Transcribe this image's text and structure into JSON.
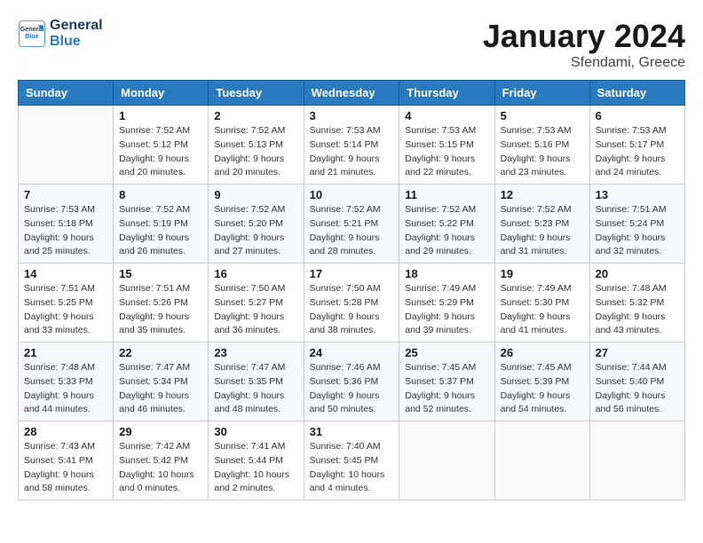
{
  "header": {
    "logo_general": "General",
    "logo_blue": "Blue",
    "title": "January 2024",
    "subtitle": "Sfendami, Greece"
  },
  "columns": [
    "Sunday",
    "Monday",
    "Tuesday",
    "Wednesday",
    "Thursday",
    "Friday",
    "Saturday"
  ],
  "weeks": [
    [
      {
        "day": "",
        "info": ""
      },
      {
        "day": "1",
        "info": "Sunrise: 7:52 AM\nSunset: 5:12 PM\nDaylight: 9 hours\nand 20 minutes."
      },
      {
        "day": "2",
        "info": "Sunrise: 7:52 AM\nSunset: 5:13 PM\nDaylight: 9 hours\nand 20 minutes."
      },
      {
        "day": "3",
        "info": "Sunrise: 7:53 AM\nSunset: 5:14 PM\nDaylight: 9 hours\nand 21 minutes."
      },
      {
        "day": "4",
        "info": "Sunrise: 7:53 AM\nSunset: 5:15 PM\nDaylight: 9 hours\nand 22 minutes."
      },
      {
        "day": "5",
        "info": "Sunrise: 7:53 AM\nSunset: 5:16 PM\nDaylight: 9 hours\nand 23 minutes."
      },
      {
        "day": "6",
        "info": "Sunrise: 7:53 AM\nSunset: 5:17 PM\nDaylight: 9 hours\nand 24 minutes."
      }
    ],
    [
      {
        "day": "7",
        "info": "Sunrise: 7:53 AM\nSunset: 5:18 PM\nDaylight: 9 hours\nand 25 minutes."
      },
      {
        "day": "8",
        "info": "Sunrise: 7:52 AM\nSunset: 5:19 PM\nDaylight: 9 hours\nand 26 minutes."
      },
      {
        "day": "9",
        "info": "Sunrise: 7:52 AM\nSunset: 5:20 PM\nDaylight: 9 hours\nand 27 minutes."
      },
      {
        "day": "10",
        "info": "Sunrise: 7:52 AM\nSunset: 5:21 PM\nDaylight: 9 hours\nand 28 minutes."
      },
      {
        "day": "11",
        "info": "Sunrise: 7:52 AM\nSunset: 5:22 PM\nDaylight: 9 hours\nand 29 minutes."
      },
      {
        "day": "12",
        "info": "Sunrise: 7:52 AM\nSunset: 5:23 PM\nDaylight: 9 hours\nand 31 minutes."
      },
      {
        "day": "13",
        "info": "Sunrise: 7:51 AM\nSunset: 5:24 PM\nDaylight: 9 hours\nand 32 minutes."
      }
    ],
    [
      {
        "day": "14",
        "info": "Sunrise: 7:51 AM\nSunset: 5:25 PM\nDaylight: 9 hours\nand 33 minutes."
      },
      {
        "day": "15",
        "info": "Sunrise: 7:51 AM\nSunset: 5:26 PM\nDaylight: 9 hours\nand 35 minutes."
      },
      {
        "day": "16",
        "info": "Sunrise: 7:50 AM\nSunset: 5:27 PM\nDaylight: 9 hours\nand 36 minutes."
      },
      {
        "day": "17",
        "info": "Sunrise: 7:50 AM\nSunset: 5:28 PM\nDaylight: 9 hours\nand 38 minutes."
      },
      {
        "day": "18",
        "info": "Sunrise: 7:49 AM\nSunset: 5:29 PM\nDaylight: 9 hours\nand 39 minutes."
      },
      {
        "day": "19",
        "info": "Sunrise: 7:49 AM\nSunset: 5:30 PM\nDaylight: 9 hours\nand 41 minutes."
      },
      {
        "day": "20",
        "info": "Sunrise: 7:48 AM\nSunset: 5:32 PM\nDaylight: 9 hours\nand 43 minutes."
      }
    ],
    [
      {
        "day": "21",
        "info": "Sunrise: 7:48 AM\nSunset: 5:33 PM\nDaylight: 9 hours\nand 44 minutes."
      },
      {
        "day": "22",
        "info": "Sunrise: 7:47 AM\nSunset: 5:34 PM\nDaylight: 9 hours\nand 46 minutes."
      },
      {
        "day": "23",
        "info": "Sunrise: 7:47 AM\nSunset: 5:35 PM\nDaylight: 9 hours\nand 48 minutes."
      },
      {
        "day": "24",
        "info": "Sunrise: 7:46 AM\nSunset: 5:36 PM\nDaylight: 9 hours\nand 50 minutes."
      },
      {
        "day": "25",
        "info": "Sunrise: 7:45 AM\nSunset: 5:37 PM\nDaylight: 9 hours\nand 52 minutes."
      },
      {
        "day": "26",
        "info": "Sunrise: 7:45 AM\nSunset: 5:39 PM\nDaylight: 9 hours\nand 54 minutes."
      },
      {
        "day": "27",
        "info": "Sunrise: 7:44 AM\nSunset: 5:40 PM\nDaylight: 9 hours\nand 56 minutes."
      }
    ],
    [
      {
        "day": "28",
        "info": "Sunrise: 7:43 AM\nSunset: 5:41 PM\nDaylight: 9 hours\nand 58 minutes."
      },
      {
        "day": "29",
        "info": "Sunrise: 7:42 AM\nSunset: 5:42 PM\nDaylight: 10 hours\nand 0 minutes."
      },
      {
        "day": "30",
        "info": "Sunrise: 7:41 AM\nSunset: 5:44 PM\nDaylight: 10 hours\nand 2 minutes."
      },
      {
        "day": "31",
        "info": "Sunrise: 7:40 AM\nSunset: 5:45 PM\nDaylight: 10 hours\nand 4 minutes."
      },
      {
        "day": "",
        "info": ""
      },
      {
        "day": "",
        "info": ""
      },
      {
        "day": "",
        "info": ""
      }
    ]
  ]
}
